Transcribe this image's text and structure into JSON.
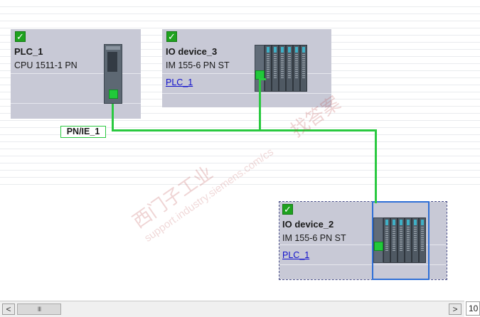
{
  "devices": {
    "plc1": {
      "name": "PLC_1",
      "type": "CPU 1511-1 PN",
      "status": "ok"
    },
    "io3": {
      "name": "IO device_3",
      "type": "IM 155-6 PN ST",
      "controller": "PLC_1",
      "status": "ok"
    },
    "io2": {
      "name": "IO device_2",
      "type": "IM 155-6 PN ST",
      "controller": "PLC_1",
      "status": "ok",
      "selected": true
    }
  },
  "subnet": {
    "label": "PN/IE_1",
    "color": "#2ac940"
  },
  "watermark": {
    "line1": "西门子工业",
    "line2": "support.industry.siemens.com/cs",
    "line3": "找答案"
  },
  "scrollbar": {
    "left_arrow": "<",
    "right_arrow": ">",
    "thumb_grip": "III",
    "zoom_value": "10"
  },
  "colors": {
    "device_bg": "#c8c9d6",
    "port": "#21c93a",
    "selection": "#2f6fd6"
  }
}
